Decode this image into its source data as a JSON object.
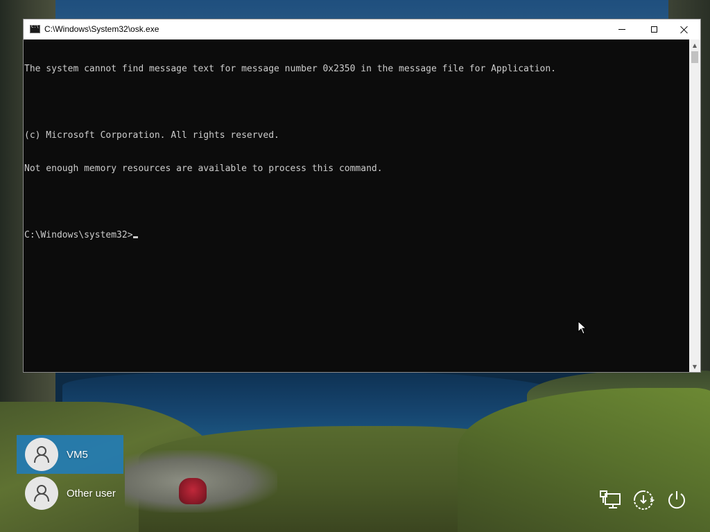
{
  "window": {
    "title": "C:\\Windows\\System32\\osk.exe",
    "minimize_label": "Minimize",
    "maximize_label": "Maximize",
    "close_label": "Close",
    "console_lines": [
      "The system cannot find message text for message number 0x2350 in the message file for Application.",
      "",
      "(c) Microsoft Corporation. All rights reserved.",
      "Not enough memory resources are available to process this command.",
      "",
      "C:\\Windows\\system32>"
    ]
  },
  "users": [
    {
      "name": "VM5",
      "selected": true,
      "icon": "user-avatar-icon"
    },
    {
      "name": "Other user",
      "selected": false,
      "icon": "user-avatar-icon"
    }
  ],
  "system_icons": [
    {
      "name": "network-icon"
    },
    {
      "name": "ease-of-access-icon"
    },
    {
      "name": "power-icon"
    }
  ],
  "colors": {
    "console_bg": "#0c0c0c",
    "console_text": "#cccccc",
    "selected_user": "#1e7cbe"
  }
}
